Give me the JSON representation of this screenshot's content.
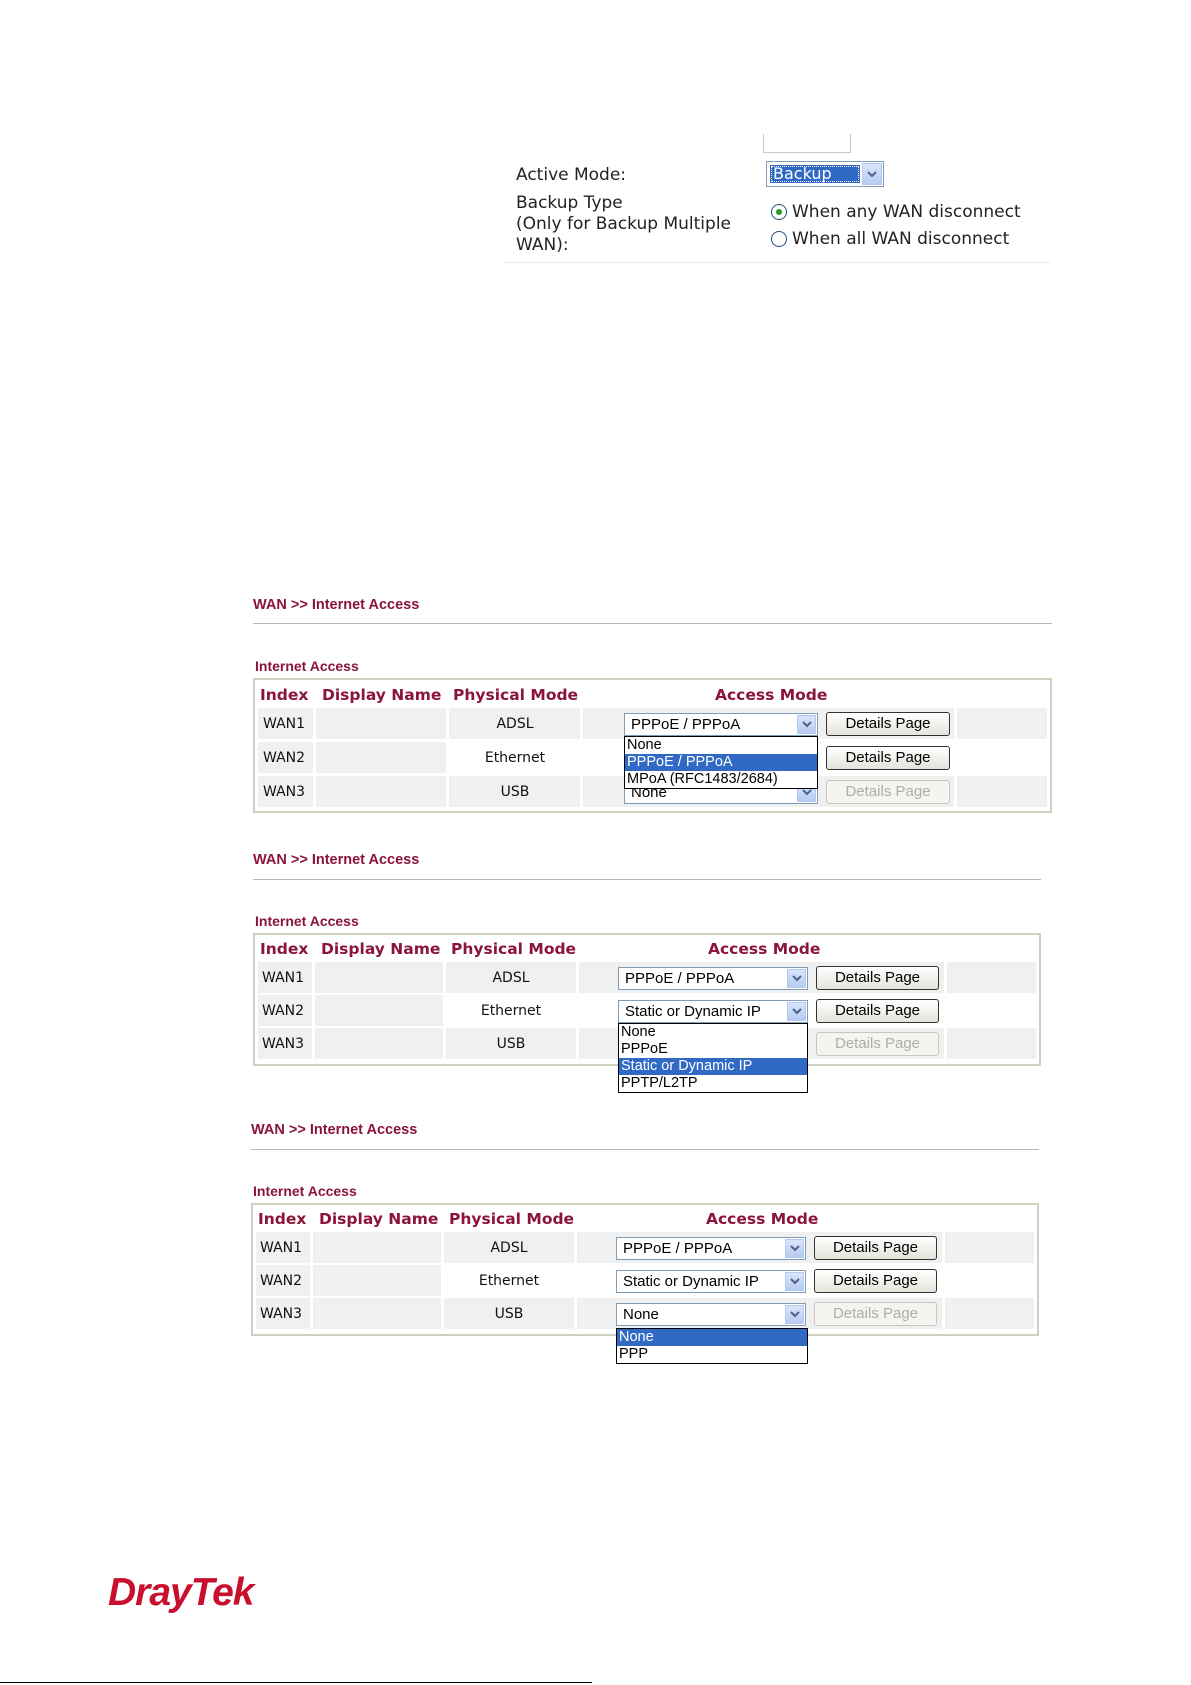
{
  "top_section": {
    "active_mode_label": "Active Mode:",
    "active_mode_value": "Backup",
    "backup_type_label_1": "Backup Type",
    "backup_type_label_2": "(Only for Backup Multiple",
    "backup_type_label_3": "WAN):",
    "radio_any": "When any WAN disconnect",
    "radio_all": "When all WAN disconnect",
    "selected_radio": "When any WAN disconnect"
  },
  "panels": [
    {
      "breadcrumb": "WAN >> Internet Access",
      "section_title": "Internet Access",
      "headers": [
        "Index",
        "Display Name",
        "Physical Mode",
        "Access Mode"
      ],
      "rows": [
        {
          "index": "WAN1",
          "display_name": "",
          "physical_mode": "ADSL",
          "access_mode": "PPPoE / PPPoA",
          "button": "Details Page"
        },
        {
          "index": "WAN2",
          "display_name": "",
          "physical_mode": "Ethernet",
          "access_mode": "",
          "button": "Details Page"
        },
        {
          "index": "WAN3",
          "display_name": "",
          "physical_mode": "USB",
          "access_mode": "None",
          "button": "Details Page"
        }
      ],
      "dropdown_options": [
        "None",
        "PPPoE / PPPoA",
        "MPoA (RFC1483/2684)"
      ],
      "dropdown_selected": "PPPoE / PPPoA"
    },
    {
      "breadcrumb": "WAN >> Internet Access",
      "section_title": "Internet Access",
      "headers": [
        "Index",
        "Display Name",
        "Physical Mode",
        "Access Mode"
      ],
      "rows": [
        {
          "index": "WAN1",
          "display_name": "",
          "physical_mode": "ADSL",
          "access_mode": "PPPoE / PPPoA",
          "button": "Details Page"
        },
        {
          "index": "WAN2",
          "display_name": "",
          "physical_mode": "Ethernet",
          "access_mode": "Static or Dynamic IP",
          "button": "Details Page"
        },
        {
          "index": "WAN3",
          "display_name": "",
          "physical_mode": "USB",
          "access_mode": "",
          "button": "Details Page"
        }
      ],
      "dropdown_options": [
        "None",
        "PPPoE",
        "Static or Dynamic IP",
        "PPTP/L2TP"
      ],
      "dropdown_selected": "Static or Dynamic IP"
    },
    {
      "breadcrumb": "WAN >> Internet Access",
      "section_title": "Internet Access",
      "headers": [
        "Index",
        "Display Name",
        "Physical Mode",
        "Access Mode"
      ],
      "rows": [
        {
          "index": "WAN1",
          "display_name": "",
          "physical_mode": "ADSL",
          "access_mode": "PPPoE / PPPoA",
          "button": "Details Page"
        },
        {
          "index": "WAN2",
          "display_name": "",
          "physical_mode": "Ethernet",
          "access_mode": "Static or Dynamic IP",
          "button": "Details Page"
        },
        {
          "index": "WAN3",
          "display_name": "",
          "physical_mode": "USB",
          "access_mode": "None",
          "button": "Details Page"
        }
      ],
      "dropdown_options": [
        "None",
        "PPP"
      ],
      "dropdown_selected": "None"
    }
  ],
  "footer": {
    "logo_text": "DrayTek",
    "brand_color": "#c8102e",
    "accent_color": "#8a1538",
    "highlight_color": "#316ac5"
  }
}
